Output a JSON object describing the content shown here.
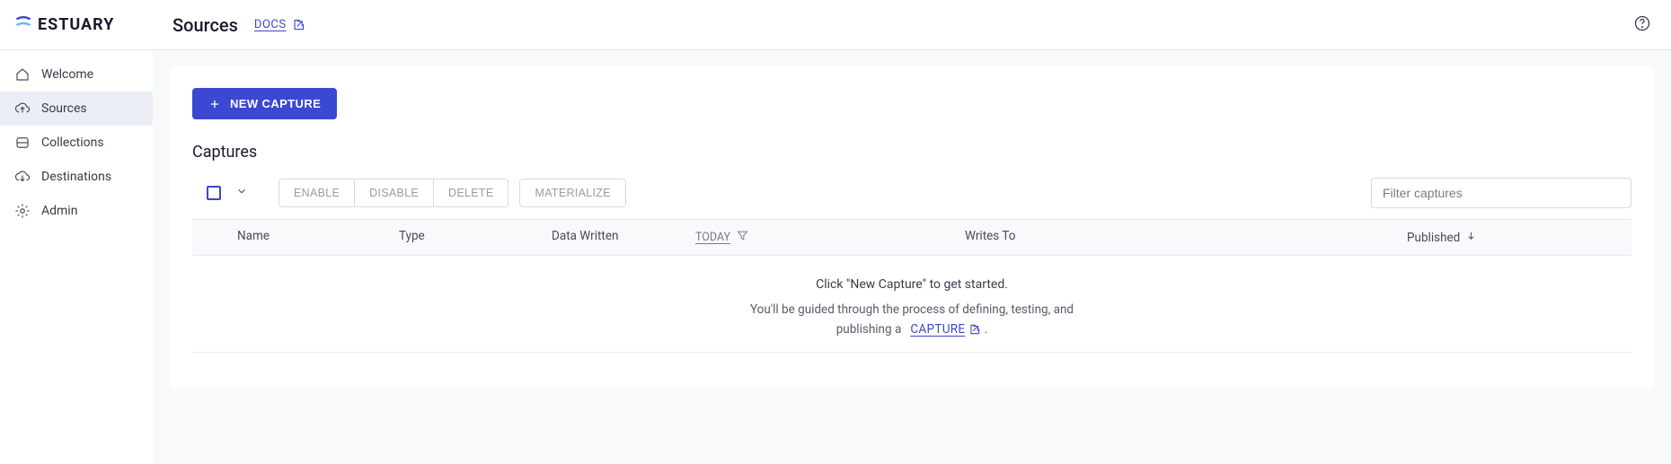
{
  "brand": "ESTUARY",
  "header": {
    "title": "Sources",
    "docs_label": "DOCS"
  },
  "sidebar": {
    "items": [
      {
        "label": "Welcome"
      },
      {
        "label": "Sources"
      },
      {
        "label": "Collections"
      },
      {
        "label": "Destinations"
      },
      {
        "label": "Admin"
      }
    ]
  },
  "actions": {
    "new_capture": "NEW CAPTURE",
    "enable": "ENABLE",
    "disable": "DISABLE",
    "delete": "DELETE",
    "materialize": "MATERIALIZE"
  },
  "section_title": "Captures",
  "filter_placeholder": "Filter captures",
  "columns": {
    "name": "Name",
    "type": "Type",
    "data_written": "Data Written",
    "today": "TODAY",
    "writes_to": "Writes To",
    "published": "Published"
  },
  "empty": {
    "lead": "Click \"New Capture\" to get started.",
    "sub1": "You'll be guided through the process of defining, testing, and",
    "sub2_prefix": "publishing a",
    "capture_link": "CAPTURE",
    "sub2_suffix": "."
  }
}
